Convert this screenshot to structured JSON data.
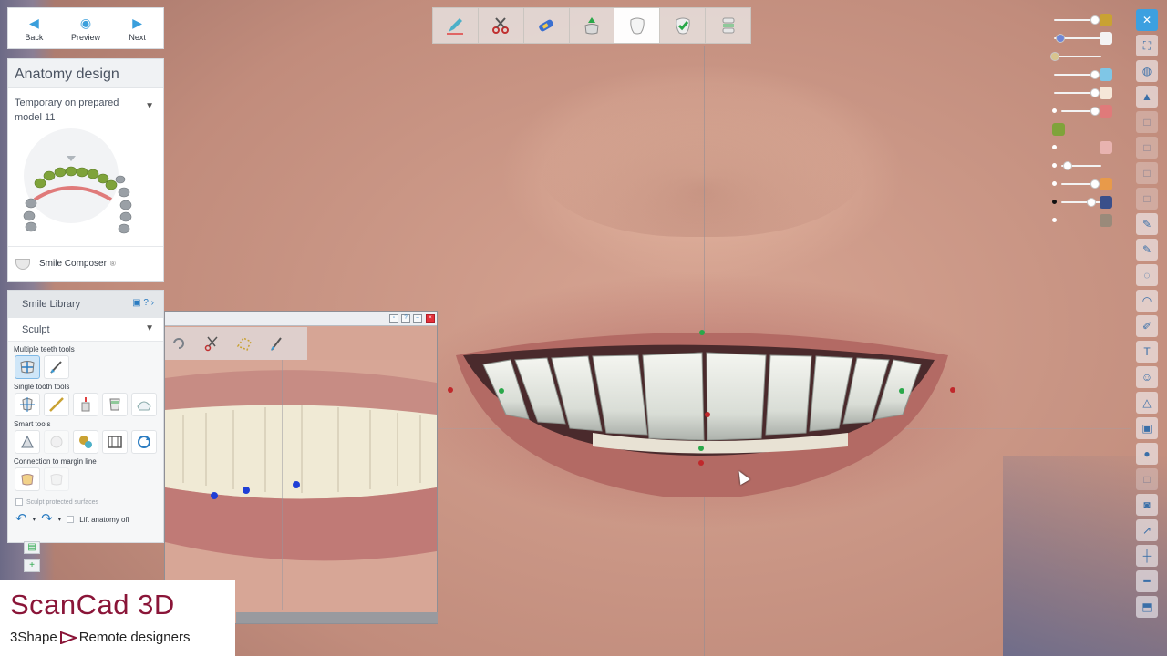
{
  "nav": {
    "back_label": "Back",
    "preview_label": "Preview",
    "next_label": "Next"
  },
  "anatomy": {
    "title": "Anatomy design",
    "case_line1": "Temporary on prepared",
    "case_line2": "model 11",
    "smile_composer_label": "Smile Composer",
    "smile_composer_mark": "®"
  },
  "sculpt_panel": {
    "smile_library_label": "Smile Library",
    "smile_library_help": "?",
    "sculpt_label": "Sculpt",
    "multiple_teeth_label": "Multiple teeth tools",
    "single_tooth_label": "Single tooth tools",
    "smart_tools_label": "Smart tools",
    "margin_line_label": "Connection to margin line",
    "protected_label": "Sculpt protected surfaces",
    "lift_anatomy_label": "Lift anatomy off"
  },
  "brand": {
    "title": "ScanCad 3D",
    "sub_left": "3Shape",
    "sub_right": "Remote designers",
    "color": "#8a1538"
  },
  "colors": {
    "accent": "#3ca0e0",
    "ctrl_red": "#c0282b",
    "ctrl_green": "#2aa84a",
    "photo_point": "#1f3fd6"
  },
  "icons": {
    "toolbar": [
      "pencil-icon",
      "scissors-icon",
      "scan-icon",
      "crown-icon",
      "tooth-icon",
      "tooth-check-icon",
      "stack-icon"
    ],
    "right": [
      "close-icon",
      "fullscreen-icon",
      "view-icon",
      "cap-icon"
    ]
  }
}
